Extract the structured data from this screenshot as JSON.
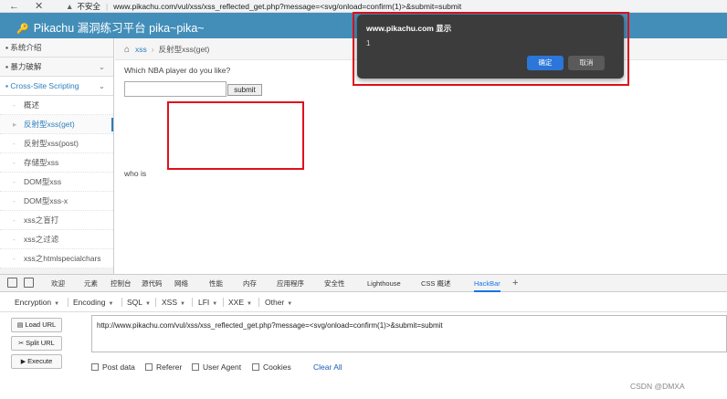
{
  "browser": {
    "insecure_label": "不安全",
    "url": "www.pikachu.com/vul/xss/xss_reflected_get.php?message=<svg/onload=confirm(1)>&submit=submit"
  },
  "site": {
    "title": "Pikachu 漏洞练习平台 pika~pika~"
  },
  "sidebar": {
    "items": [
      {
        "label": "系统介绍"
      },
      {
        "label": "暴力破解"
      },
      {
        "label": "Cross-Site Scripting"
      }
    ],
    "sub_items": [
      {
        "label": "概述"
      },
      {
        "label": "反射型xss(get)"
      },
      {
        "label": "反射型xss(post)"
      },
      {
        "label": "存储型xss"
      },
      {
        "label": "DOM型xss"
      },
      {
        "label": "DOM型xss-x"
      },
      {
        "label": "xss之盲打"
      },
      {
        "label": "xss之过滤"
      },
      {
        "label": "xss之htmlspecialchars"
      }
    ]
  },
  "breadcrumb": {
    "section": "xss",
    "page": "反射型xss(get)"
  },
  "content": {
    "question": "Which NBA player do you like?",
    "input_value": "",
    "submit_label": "submit",
    "result_text": "who is"
  },
  "dialog": {
    "title": "www.pikachu.com 显示",
    "message": "1",
    "ok_label": "确定",
    "cancel_label": "取消"
  },
  "devtools": {
    "tabs": [
      "欢迎",
      "元素",
      "控制台",
      "源代码",
      "网络",
      "性能",
      "内存",
      "应用程序",
      "安全性",
      "Lighthouse",
      "CSS 概述",
      "HackBar"
    ],
    "active_tab": "HackBar"
  },
  "hackbar": {
    "menus": [
      "Encryption",
      "Encoding",
      "SQL",
      "XSS",
      "LFI",
      "XXE",
      "Other"
    ],
    "load_url": "Load URL",
    "split_url": "Split URL",
    "execute": "Execute",
    "url_value": "http://www.pikachu.com/vul/xss/xss_reflected_get.php?message=<svg/onload=confirm(1)>&submit=submit",
    "options": [
      "Post data",
      "Referer",
      "User Agent",
      "Cookies"
    ],
    "clear_all": "Clear All"
  },
  "watermark": "CSDN @DMXA",
  "colors": {
    "header": "#438eb9",
    "link": "#2b7dbc",
    "annotation": "#e0101a",
    "dialog_ok": "#2b76d8"
  }
}
